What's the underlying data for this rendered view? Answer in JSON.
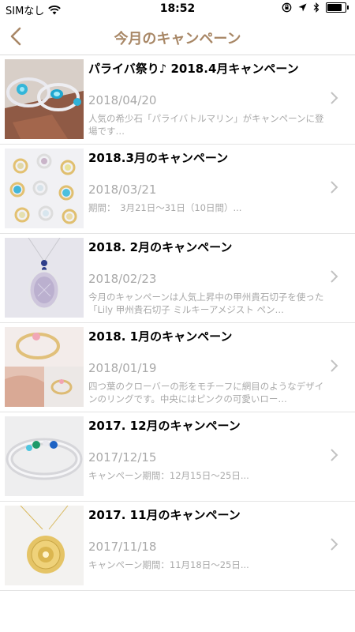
{
  "status_bar": {
    "carrier": "SIMなし",
    "time": "18:52"
  },
  "nav": {
    "title": "今月のキャンペーン"
  },
  "campaigns": [
    {
      "title": "パライバ祭り♪ 2018.4月キャンペーン",
      "date": "2018/04/20",
      "description": "人気の希少石「パライバトルマリン」がキャンペーンに登場です…"
    },
    {
      "title": "2018.3月のキャンペーン",
      "date": "2018/03/21",
      "description": "期間：　3月21日〜31日（10日間）..."
    },
    {
      "title": "2018. 2月のキャンペーン",
      "date": "2018/02/23",
      "description": "今月のキャンペーンは人気上昇中の甲州貴石切子を使った「Lily 甲州貴石切子 ミルキーアメジスト ペン…"
    },
    {
      "title": "2018. 1月のキャンペーン",
      "date": "2018/01/19",
      "description": "四つ葉のクローバーの形をモチーフに網目のようなデザインのリングです。中央にはピンクの可愛いロー…"
    },
    {
      "title": "2017. 12月のキャンペーン",
      "date": "2017/12/15",
      "description": "キャンペーン期間：12月15日〜25日..."
    },
    {
      "title": "2017. 11月のキャンペーン",
      "date": "2017/11/18",
      "description": "キャンペーン期間：11月18日〜25日..."
    }
  ]
}
